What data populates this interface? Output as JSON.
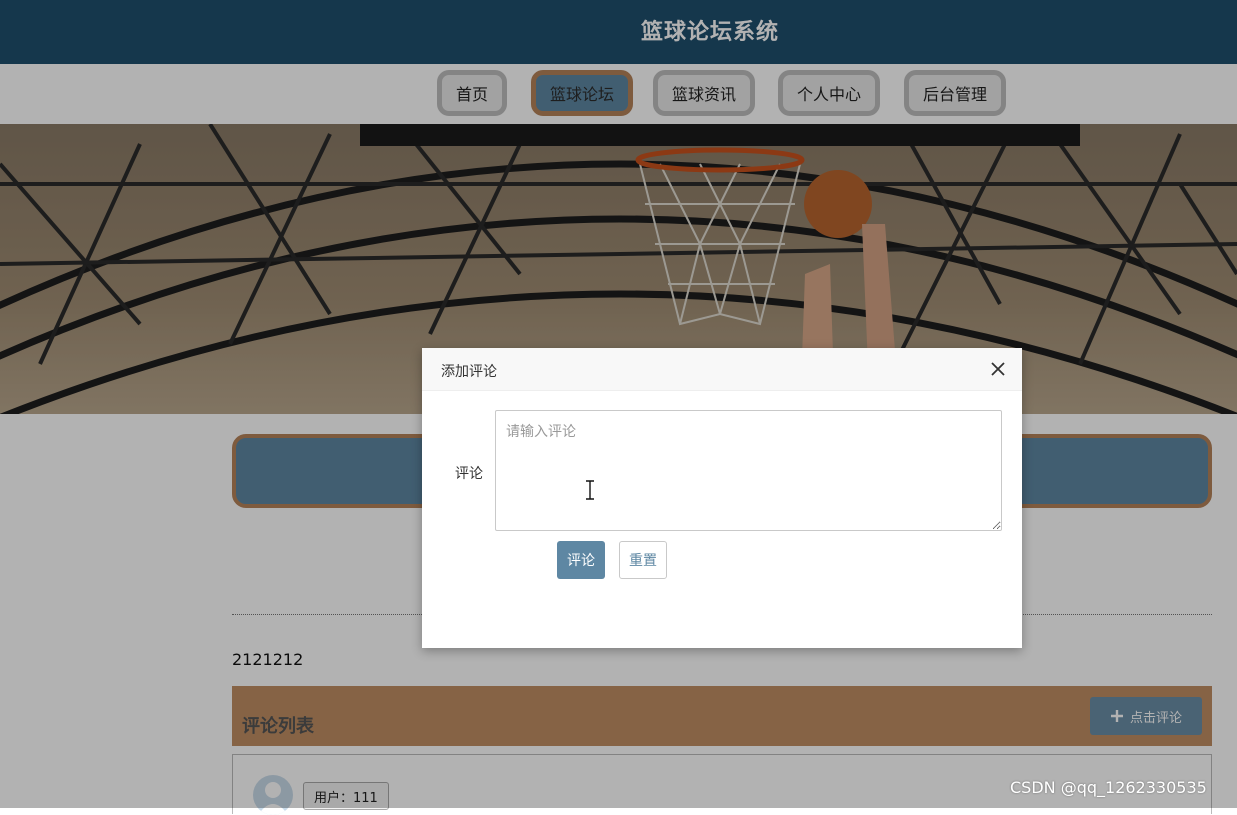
{
  "header": {
    "title": "篮球论坛系统"
  },
  "nav": {
    "items": [
      {
        "label": "首页",
        "active": false
      },
      {
        "label": "篮球论坛",
        "active": true
      },
      {
        "label": "篮球资讯",
        "active": false
      },
      {
        "label": "个人中心",
        "active": false
      },
      {
        "label": "后台管理",
        "active": false
      }
    ]
  },
  "post": {
    "content": "2121212"
  },
  "comments": {
    "header_label": "评论列表",
    "add_button_label": "点击评论",
    "items": [
      {
        "user": "用户：111"
      }
    ]
  },
  "dialog": {
    "title": "添加评论",
    "field_label": "评论",
    "textarea_placeholder": "请输入评论",
    "textarea_value": "",
    "submit_label": "评论",
    "reset_label": "重置"
  },
  "watermark": "CSDN @qq_1262330535",
  "colors": {
    "header_bg": "#1f4f6e",
    "accent": "#5e87a3",
    "border_accent": "#b5835a",
    "comments_bar": "#c18f63"
  },
  "icons": {
    "close": "close-icon",
    "add": "plus-icon",
    "avatar": "user-avatar-icon",
    "cursor": "text-cursor-icon"
  }
}
